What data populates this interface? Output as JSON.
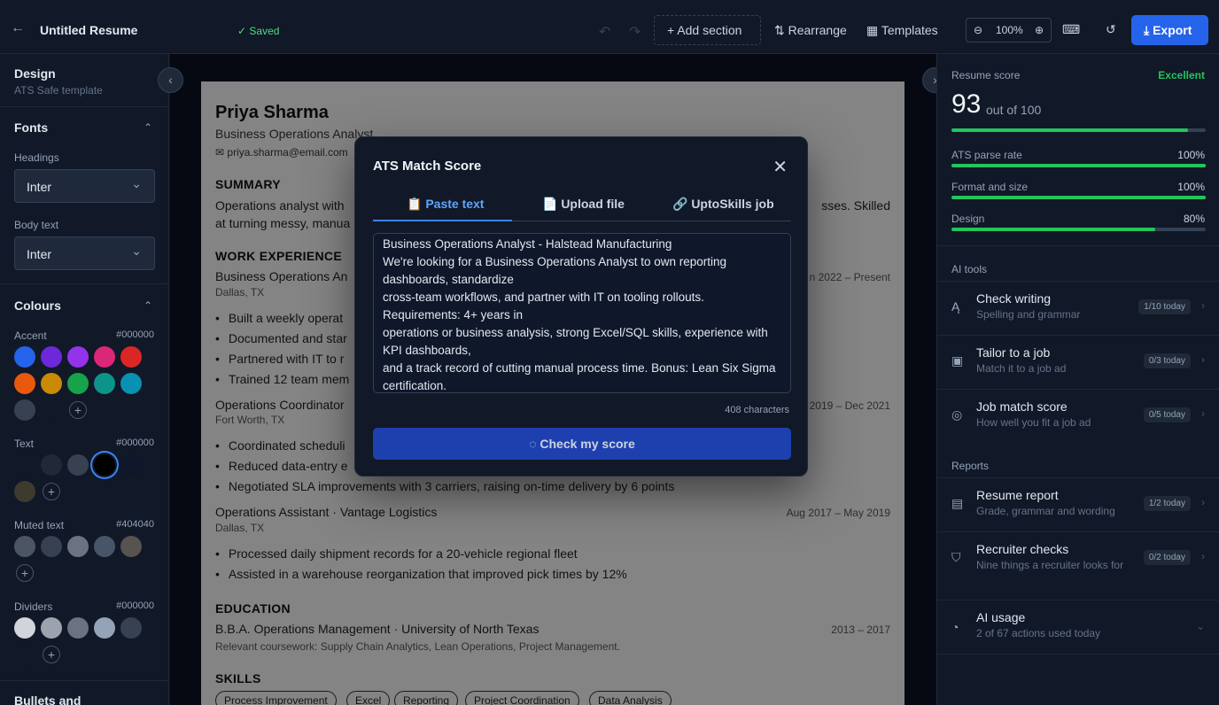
{
  "topbar": {
    "title": "Untitled Resume",
    "saved": "✓ Saved",
    "add_section": "+ Add section",
    "rearrange": "⇅ Rearrange",
    "templates": "▦ Templates",
    "zoom": "100%",
    "export": "⤓ Export"
  },
  "left": {
    "design_title": "Design",
    "design_sub": "ATS Safe template",
    "fonts_title": "Fonts",
    "headings_label": "Headings",
    "headings_value": "Inter",
    "body_label": "Body text",
    "body_value": "Inter",
    "colours_title": "Colours",
    "accent_label": "Accent",
    "accent_hex": "#000000",
    "text_label": "Text",
    "text_hex": "#000000",
    "muted_label": "Muted text",
    "muted_hex": "#404040",
    "dividers_label": "Dividers",
    "dividers_hex": "#000000",
    "bullets_title": "Bullets and",
    "accent_colors": [
      "#2563eb",
      "#6d28d9",
      "#9333ea",
      "#db2777",
      "#dc2626",
      "#ea580c",
      "#ca8a04",
      "#16a34a",
      "#0d9488",
      "#0891b2",
      "#374151",
      "#111827"
    ],
    "text_colors": [
      "#111827",
      "#1f2937",
      "#374151",
      "#000000",
      "#0f172a",
      "#3f3a2e"
    ],
    "muted_colors": [
      "#4b5563",
      "#374151",
      "#6b7280",
      "#475569",
      "#57534e"
    ],
    "divider_colors": [
      "#d1d5db",
      "#9ca3af",
      "#6b7280",
      "#94a3b8",
      "#374151",
      "#111827"
    ]
  },
  "resume": {
    "name": "Priya Sharma",
    "title": "Business Operations Analyst",
    "email": "✉ priya.sharma@email.com",
    "summary_h": "SUMMARY",
    "summary_1": "Operations analyst with",
    "summary_1r": "sses. Skilled",
    "summary_2": "at turning messy, manua",
    "work_h": "WORK EXPERIENCE",
    "job1_title": "Business Operations An",
    "job1_date": "n 2022 – Present",
    "job1_loc": "Dallas, TX",
    "job1_b1": "Built a weekly operat",
    "job1_b2": "Documented and star",
    "job1_b3": "Partnered with IT to r",
    "job1_b4": "Trained 12 team mem",
    "job2_title": "Operations Coordinator",
    "job2_date": "2019 – Dec 2021",
    "job2_loc": "Fort Worth, TX",
    "job2_b1": "Coordinated scheduli",
    "job2_b2": "Reduced data-entry e",
    "job2_b3": "Negotiated SLA improvements with 3 carriers, raising on-time delivery by 6 points",
    "job3_title": "Operations Assistant · Vantage Logistics",
    "job3_date": "Aug 2017 – May 2019",
    "job3_loc": "Dallas, TX",
    "job3_b1": "Processed daily shipment records for a 20-vehicle regional fleet",
    "job3_b2": "Assisted in a warehouse reorganization that improved pick times by 12%",
    "edu_h": "EDUCATION",
    "edu_deg": "B.B.A. Operations Management · University of North Texas",
    "edu_date": "2013 – 2017",
    "edu_course": "Relevant coursework: Supply Chain Analytics, Lean Operations, Project Management.",
    "skills_h": "SKILLS",
    "skills": [
      "Process Improvement",
      "Excel",
      "Reporting",
      "Project Coordination",
      "Data Analysis"
    ]
  },
  "modal": {
    "title": "ATS Match Score",
    "tab_paste": "📋 Paste text",
    "tab_upload": "📄 Upload file",
    "tab_job": "🔗 UptoSkills job",
    "text": "Business Operations Analyst - Halstead Manufacturing\nWe're looking for a Business Operations Analyst to own reporting dashboards, standardize\ncross-team workflows, and partner with IT on tooling rollouts. Requirements: 4+ years in\noperations or business analysis, strong Excel/SQL skills, experience with KPI dashboards,\nand a track record of cutting manual process time. Bonus: Lean Six Sigma certification.",
    "count": "408 characters",
    "button": "◌  Check my score"
  },
  "right": {
    "score_label": "Resume score",
    "score_rating": "Excellent",
    "score_value": "93",
    "score_of": "out of 100",
    "score_fraction": 0.93,
    "metrics": [
      {
        "label": "ATS parse rate",
        "value": "100%",
        "fraction": 1.0
      },
      {
        "label": "Format and size",
        "value": "100%",
        "fraction": 1.0
      },
      {
        "label": "Design",
        "value": "80%",
        "fraction": 0.8
      }
    ],
    "ai_tools_h": "AI tools",
    "tools": [
      {
        "title": "Check writing",
        "sub": "Spelling and grammar",
        "badge": "1/10 today",
        "icon": "Ą"
      },
      {
        "title": "Tailor to a job",
        "sub": "Match it to a job ad",
        "badge": "0/3 today",
        "icon": "▣"
      },
      {
        "title": "Job match score",
        "sub": "How well you fit a job ad",
        "badge": "0/5 today",
        "icon": "◎"
      }
    ],
    "reports_h": "Reports",
    "reports": [
      {
        "title": "Resume report",
        "sub": "Grade, grammar and wording",
        "badge": "1/2 today",
        "icon": "▤"
      },
      {
        "title": "Recruiter checks",
        "sub": "Nine things a recruiter looks for",
        "badge": "0/2 today",
        "icon": "⛉"
      }
    ],
    "usage_title": "AI usage",
    "usage_sub": "2 of 67 actions used today"
  }
}
